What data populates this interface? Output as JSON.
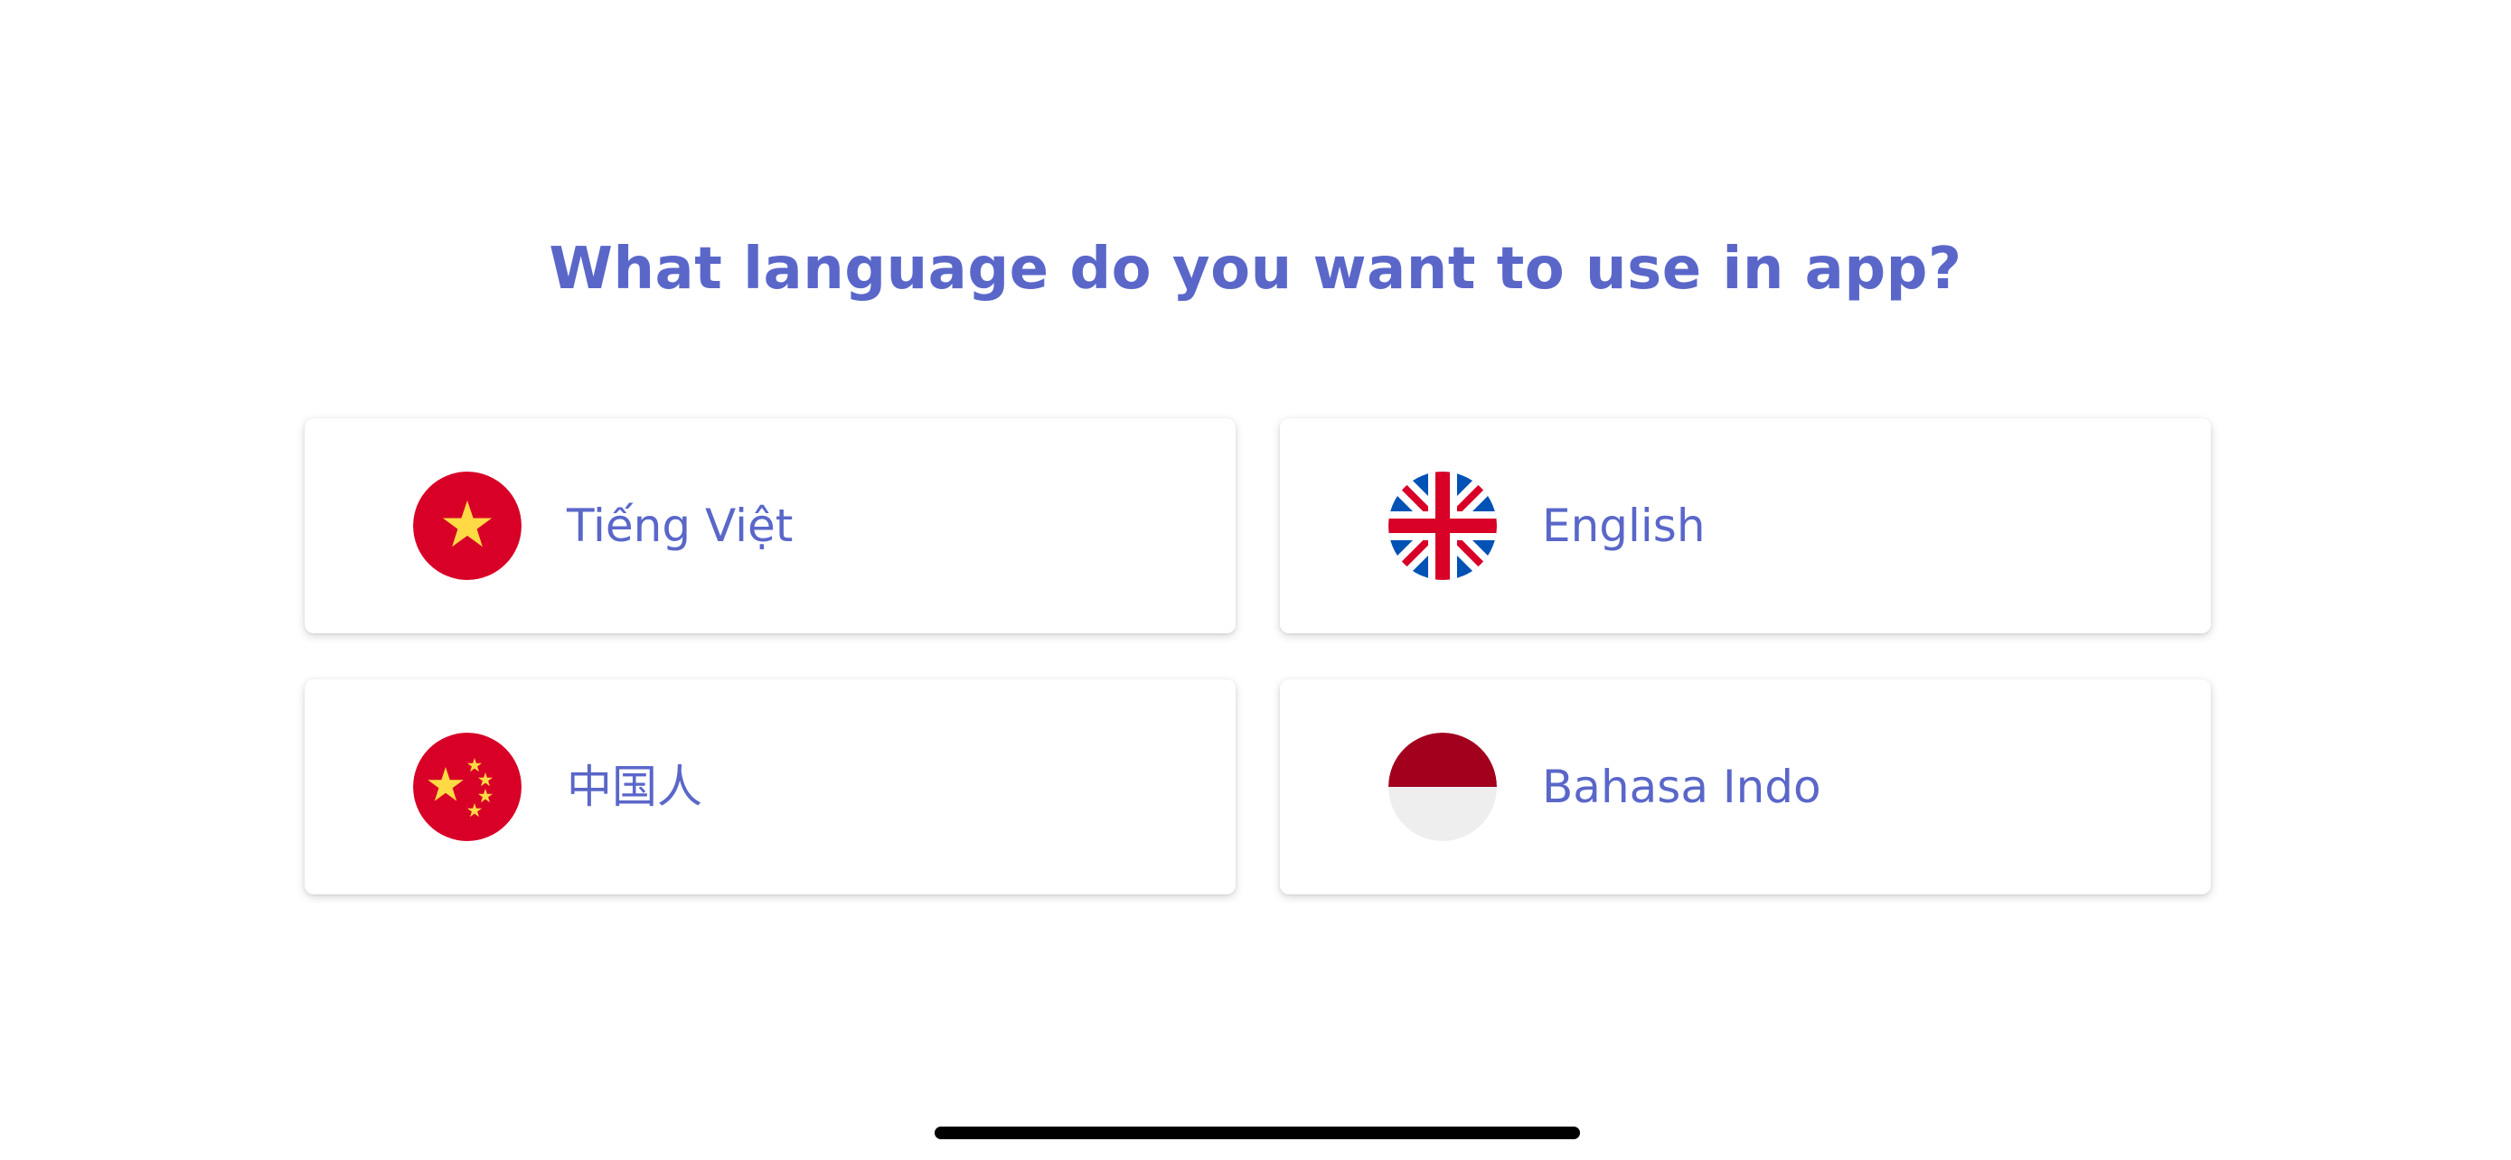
{
  "title": "What language do you want to use in app?",
  "languages": [
    {
      "label": "Tiếng Việt",
      "flag": "vietnam-flag-icon"
    },
    {
      "label": "English",
      "flag": "uk-flag-icon"
    },
    {
      "label": "中国人",
      "flag": "china-flag-icon"
    },
    {
      "label": "Bahasa Indo",
      "flag": "indonesia-flag-icon"
    }
  ],
  "colors": {
    "accent": "#5a67c9",
    "flag_red": "#d80027",
    "flag_yellow": "#ffda44",
    "uk_blue": "#0052b4",
    "indo_red": "#a2001d",
    "indo_white": "#eeeeee"
  }
}
